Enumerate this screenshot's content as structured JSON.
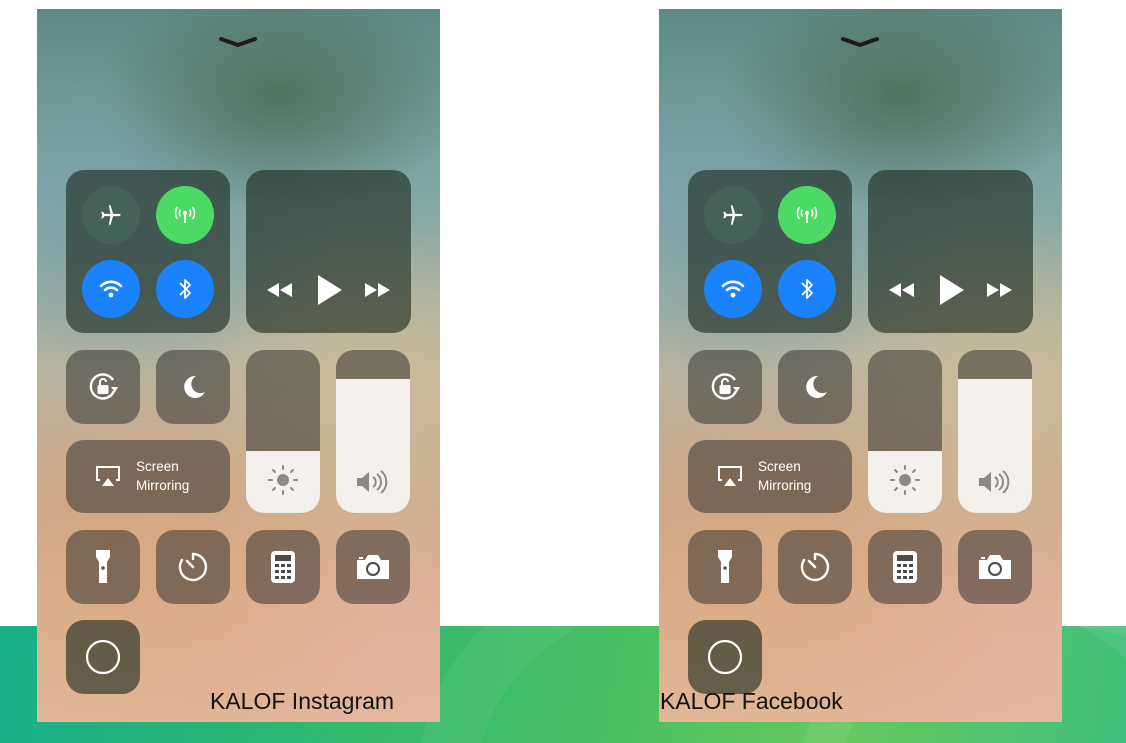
{
  "captions": {
    "left": "KALOF Instagram",
    "right": "KALOF Facebook"
  },
  "control_center": {
    "screen_mirroring_label": "Screen\nMirroring",
    "toggles": {
      "airplane_mode": "off",
      "cellular_data": "on",
      "wifi": "on",
      "bluetooth": "on"
    },
    "brightness_level": 0.38,
    "volume_level": 0.82,
    "icons": [
      "chevron-down-icon",
      "airplane-icon",
      "cellular-antenna-icon",
      "wifi-icon",
      "bluetooth-icon",
      "rewind-icon",
      "play-icon",
      "fast-forward-icon",
      "rotation-lock-icon",
      "moon-icon",
      "airplay-icon",
      "sun-icon",
      "speaker-icon",
      "flashlight-icon",
      "timer-icon",
      "calculator-icon",
      "camera-icon",
      "screen-record-icon"
    ]
  },
  "colors": {
    "cellular_green": "#4cd964",
    "active_blue": "#1a82fb",
    "band_green": "#2fb86f"
  }
}
